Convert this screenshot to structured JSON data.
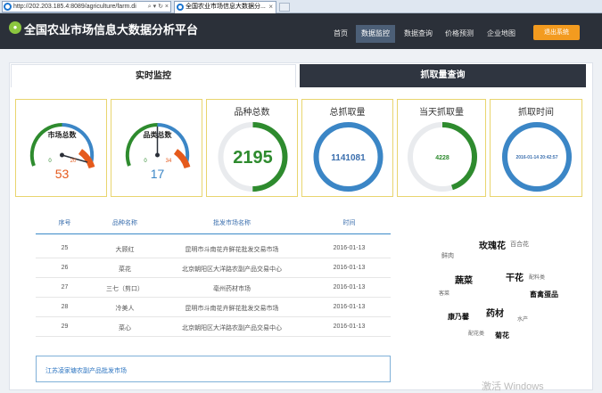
{
  "browser": {
    "url": "http://202.203.185.4:8089/agriculture/farm.di",
    "tab_title": "全国农业市场信息大数据分..."
  },
  "app": {
    "title": "全国农业市场信息大数据分析平台",
    "nav": [
      "首页",
      "数据监控",
      "数据查询",
      "价格预测",
      "企业地图"
    ],
    "active_nav": "数据监控",
    "exit_label": "退出系统"
  },
  "tabs": {
    "realtime": "实时监控",
    "query": "抓取量查询"
  },
  "gauges": {
    "market": {
      "label": "市场总数",
      "value": "53",
      "min": "0",
      "max": "20"
    },
    "category": {
      "label": "品类总数",
      "value": "17",
      "min": "0",
      "max": "34"
    }
  },
  "stats": {
    "variety": {
      "label": "品种总数",
      "value": "2195",
      "fraction": 0.5,
      "color": "#2e8b2e"
    },
    "total": {
      "label": "总抓取量",
      "value": "1141081",
      "fraction": 1.0,
      "color": "#3b86c6"
    },
    "today": {
      "label": "当天抓取量",
      "value": "4228",
      "fraction": 0.45,
      "color": "#2e8b2e"
    },
    "time": {
      "label": "抓取时间",
      "value": "2016-01-14 20:42:57",
      "fraction": 1.0,
      "color": "#3b86c6"
    }
  },
  "table": {
    "columns": [
      "序号",
      "品种名称",
      "批发市场名称",
      "时间"
    ],
    "rows": [
      [
        "25",
        "大顾红",
        "昆明市斗南花卉鲜花批发交易市场",
        "2016-01-13"
      ],
      [
        "26",
        "菜花",
        "北京朝阳区大洋路农副产品交易中心",
        "2016-01-13"
      ],
      [
        "27",
        "三七（剪口）",
        "亳州药材市场",
        "2016-01-13"
      ],
      [
        "28",
        "冷美人",
        "昆明市斗南花卉鲜花批发交易市场",
        "2016-01-13"
      ],
      [
        "29",
        "菜心",
        "北京朝阳区大洋路农副产品交易中心",
        "2016-01-13"
      ]
    ]
  },
  "market_input": "江苏凌家塘农副产品批发市场",
  "word_cloud": [
    {
      "text": "玫瑰花",
      "size": 10,
      "bold": true
    },
    {
      "text": "百合花",
      "size": 7,
      "bold": false
    },
    {
      "text": "鲜肉",
      "size": 7,
      "bold": false
    },
    {
      "text": "蔬菜",
      "size": 10,
      "bold": true
    },
    {
      "text": "干花",
      "size": 10,
      "bold": true
    },
    {
      "text": "配料类",
      "size": 6,
      "bold": false
    },
    {
      "text": "畜禽蛋品",
      "size": 8,
      "bold": true
    },
    {
      "text": "客菜",
      "size": 6,
      "bold": false
    },
    {
      "text": "药材",
      "size": 10,
      "bold": true
    },
    {
      "text": "康乃馨",
      "size": 8,
      "bold": true
    },
    {
      "text": "水产",
      "size": 6,
      "bold": false
    },
    {
      "text": "配花类",
      "size": 6,
      "bold": false
    },
    {
      "text": "菊花",
      "size": 8,
      "bold": true
    }
  ],
  "watermark": "激活 Windows"
}
